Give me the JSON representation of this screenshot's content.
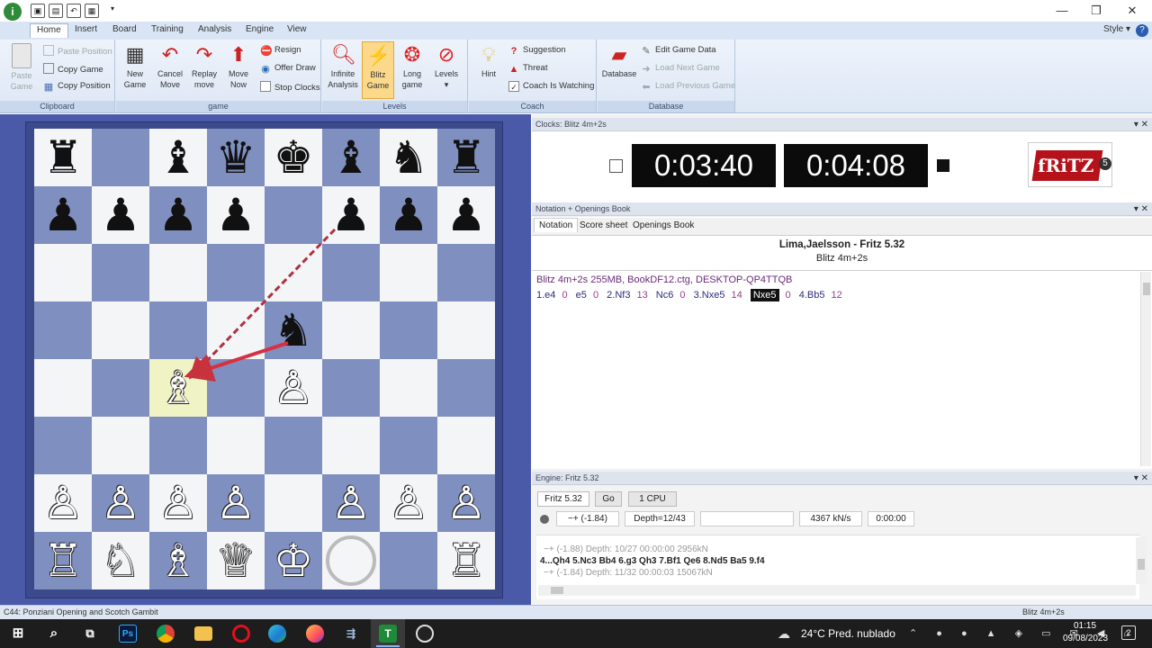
{
  "menu": {
    "items": [
      "Home",
      "Insert",
      "Board",
      "Training",
      "Analysis",
      "Engine",
      "View"
    ],
    "style_label": "Style"
  },
  "ribbon": {
    "clipboard": {
      "paste_game": "Paste\nGame",
      "paste_position": "Paste Position",
      "copy_game": "Copy Game",
      "copy_position": "Copy Position",
      "group": "Clipboard"
    },
    "game": {
      "new_game": "New\nGame",
      "cancel_move": "Cancel\nMove",
      "replay_move": "Replay\nmove",
      "move_now": "Move\nNow",
      "resign": "Resign",
      "offer_draw": "Offer Draw",
      "stop_clocks": "Stop Clocks",
      "group": "game"
    },
    "levels": {
      "infinite": "Infinite\nAnalysis",
      "blitz": "Blitz\nGame",
      "long": "Long\ngame",
      "levels": "Levels",
      "group": "Levels"
    },
    "coach": {
      "hint": "Hint",
      "suggestion": "Suggestion",
      "threat": "Threat",
      "coach_watching": "Coach Is Watching",
      "group": "Coach"
    },
    "database": {
      "database": "Database",
      "edit_game_data": "Edit Game Data",
      "load_next": "Load Next Game",
      "load_previous": "Load Previous Game",
      "group": "Database"
    }
  },
  "board": {
    "squares": [
      [
        "♜",
        "",
        "♝",
        "♛",
        "♚",
        "♝",
        "♞",
        "♜"
      ],
      [
        "♟",
        "♟",
        "♟",
        "♟",
        "",
        "♟",
        "♟",
        "♟"
      ],
      [
        "",
        "",
        "",
        "",
        "",
        "",
        "",
        ""
      ],
      [
        "",
        "",
        "",
        "",
        "♞",
        "",
        "",
        ""
      ],
      [
        "",
        "",
        "♗",
        "",
        "♙",
        "",
        "",
        ""
      ],
      [
        "",
        "",
        "",
        "",
        "",
        "",
        "",
        ""
      ],
      [
        "♙",
        "♙",
        "♙",
        "♙",
        "",
        "♙",
        "♙",
        "♙"
      ],
      [
        "♖",
        "♘",
        "♗",
        "♕",
        "♔",
        "",
        "",
        "♖"
      ]
    ],
    "colors": [
      [
        "b",
        "",
        "b",
        "b",
        "b",
        "b",
        "b",
        "b"
      ],
      [
        "b",
        "b",
        "b",
        "b",
        "",
        "b",
        "b",
        "b"
      ],
      [
        "",
        "",
        "",
        "",
        "",
        "",
        "",
        ""
      ],
      [
        "",
        "",
        "",
        "",
        "b",
        "",
        "",
        ""
      ],
      [
        "",
        "",
        "w",
        "",
        "w",
        "",
        "",
        ""
      ],
      [
        "",
        "",
        "",
        "",
        "",
        "",
        "",
        ""
      ],
      [
        "w",
        "w",
        "w",
        "w",
        "",
        "w",
        "w",
        "w"
      ],
      [
        "w",
        "w",
        "w",
        "w",
        "w",
        "",
        "",
        "w"
      ]
    ],
    "highlight": "c4"
  },
  "clocks": {
    "title": "Clocks: Blitz 4m+2s",
    "white_time": "0:03:40",
    "black_time": "0:04:08",
    "logo_text": "fRiTZ",
    "logo_version": "5"
  },
  "notation": {
    "title": "Notation + Openings Book",
    "tabs": [
      "Notation",
      "Score sheet",
      "Openings Book"
    ],
    "players": "Lima,Jaelsson - Fritz 5.32",
    "event": "Blitz 4m+2s",
    "info": "Blitz 4m+2s  255MB, BookDF12.ctg, DESKTOP-QP4TTQB",
    "moves": [
      {
        "t": "1.e4",
        "c": "0"
      },
      {
        "t": "e5",
        "c": "0"
      },
      {
        "t": "2.Nf3",
        "c": "13"
      },
      {
        "t": "Nc6",
        "c": "0"
      },
      {
        "t": "3.Nxe5",
        "c": "14"
      },
      {
        "t": "Nxe5",
        "c": "0",
        "sel": true
      },
      {
        "t": "4.Bb5",
        "c": "12"
      }
    ]
  },
  "engine": {
    "title": "Engine: Fritz 5.32",
    "name": "Fritz 5.32",
    "go": "Go",
    "cpu": "1 CPU",
    "eval": "−+ (-1.84)",
    "depth": "Depth=12/43",
    "speed": "4367 kN/s",
    "time": "0:00:00",
    "line1": "−+ (-1.88)  Depth: 10/27  00:00:00  2956kN",
    "line2": "4...Qh4 5.Nc3 Bb4 6.g3 Qh3 7.Bf1 Qe6 8.Nd5 Ba5 9.f4",
    "line3": "−+ (-1.84)  Depth: 11/32  00:00:03  15067kN"
  },
  "status": {
    "opening": "C44: Ponziani Opening and Scotch Gambit",
    "mode": "Blitz 4m+2s"
  },
  "taskbar": {
    "weather": "24°C  Pred. nublado",
    "time": "01:15",
    "date": "09/08/2023"
  }
}
